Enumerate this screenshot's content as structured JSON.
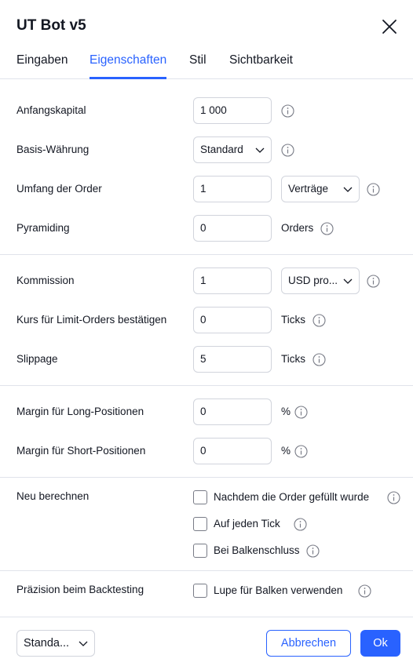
{
  "dialog": {
    "title": "UT Bot v5",
    "close_icon": "close-icon"
  },
  "tabs": [
    {
      "label": "Eingaben",
      "active": false
    },
    {
      "label": "Eigenschaften",
      "active": true
    },
    {
      "label": "Stil",
      "active": false
    },
    {
      "label": "Sichtbarkeit",
      "active": false
    }
  ],
  "fields": {
    "initial_capital": {
      "label": "Anfangskapital",
      "value": "1 000"
    },
    "base_currency": {
      "label": "Basis-Währung",
      "value": "Standard"
    },
    "order_size": {
      "label": "Umfang der Order",
      "value": "1",
      "unit": "Verträge"
    },
    "pyramiding": {
      "label": "Pyramiding",
      "value": "0",
      "unit": "Orders"
    },
    "commission": {
      "label": "Kommission",
      "value": "1",
      "unit": "USD pro..."
    },
    "limit_orders": {
      "label": "Kurs für Limit-Orders bestätigen",
      "value": "0",
      "unit": "Ticks"
    },
    "slippage": {
      "label": "Slippage",
      "value": "5",
      "unit": "Ticks"
    },
    "margin_long": {
      "label": "Margin für Long-Positionen",
      "value": "0",
      "unit": "%"
    },
    "margin_short": {
      "label": "Margin für Short-Positionen",
      "value": "0",
      "unit": "%"
    }
  },
  "recalculate": {
    "label": "Neu berechnen",
    "options": [
      {
        "label": "Nachdem die Order gefüllt wurde",
        "checked": false
      },
      {
        "label": "Auf jeden Tick",
        "checked": false
      },
      {
        "label": "Bei Balkenschluss",
        "checked": false
      }
    ]
  },
  "backtest_precision": {
    "label": "Präzision beim Backtesting",
    "option": {
      "label": "Lupe für Balken verwenden",
      "checked": false
    }
  },
  "footer": {
    "template_select": "Standa...",
    "cancel_label": "Abbrechen",
    "ok_label": "Ok"
  },
  "colors": {
    "accent": "#2962ff",
    "text": "#131722",
    "border": "#d1d4dc",
    "divider": "#e0e3eb"
  }
}
